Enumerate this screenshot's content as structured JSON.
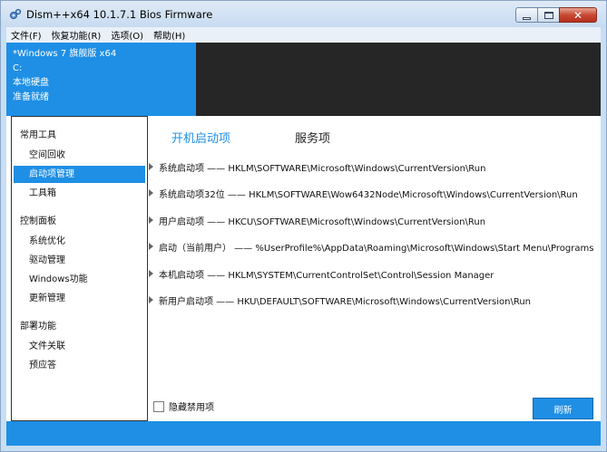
{
  "window": {
    "title": "Dism++x64 10.1.7.1 Bios Firmware",
    "icon": "dism-gears-icon"
  },
  "menu": [
    "文件(F)",
    "恢复功能(R)",
    "选项(O)",
    "帮助(H)"
  ],
  "system_info": {
    "os": "*Windows 7 旗舰版 x64",
    "drive": "C:",
    "disk": "本地硬盘",
    "status": "准备就绪"
  },
  "sidebar": {
    "groups": [
      {
        "title": "常用工具",
        "items": [
          "空间回收",
          "启动项管理",
          "工具箱"
        ]
      },
      {
        "title": "控制面板",
        "items": [
          "系统优化",
          "驱动管理",
          "Windows功能",
          "更新管理"
        ]
      },
      {
        "title": "部署功能",
        "items": [
          "文件关联",
          "预应答"
        ]
      }
    ],
    "selected": "启动项管理"
  },
  "tabs": [
    {
      "label": "开机启动项",
      "active": true
    },
    {
      "label": "服务项",
      "active": false
    }
  ],
  "startup_entries": [
    "系统启动项 —— HKLM\\SOFTWARE\\Microsoft\\Windows\\CurrentVersion\\Run",
    "系统启动项32位 —— HKLM\\SOFTWARE\\Wow6432Node\\Microsoft\\Windows\\CurrentVersion\\Run",
    "用户启动项 —— HKCU\\SOFTWARE\\Microsoft\\Windows\\CurrentVersion\\Run",
    "启动（当前用户） —— %UserProfile%\\AppData\\Roaming\\Microsoft\\Windows\\Start Menu\\Programs",
    "本机启动项 —— HKLM\\SYSTEM\\CurrentControlSet\\Control\\Session Manager",
    "新用户启动项 —— HKU\\DEFAULT\\SOFTWARE\\Microsoft\\Windows\\CurrentVersion\\Run"
  ],
  "footer": {
    "hide_disabled_label": "隐藏禁用项",
    "hide_disabled_checked": false,
    "refresh_label": "刷新"
  },
  "colors": {
    "accent": "#1e8fe5",
    "header_dark": "#262626"
  }
}
